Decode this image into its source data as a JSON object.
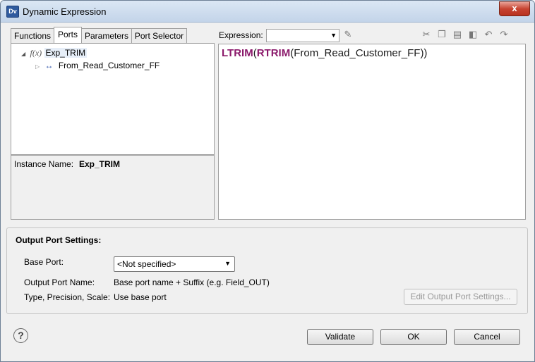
{
  "window": {
    "title": "Dynamic Expression",
    "app_icon": "Dv",
    "close_label": "x"
  },
  "left_panel": {
    "tabs": [
      {
        "label": "Functions"
      },
      {
        "label": "Ports"
      },
      {
        "label": "Parameters"
      },
      {
        "label": "Port Selector"
      }
    ],
    "tree": {
      "root_label": "Exp_TRIM",
      "root_icon": "f(x)",
      "child_label": "From_Read_Customer_FF"
    },
    "instance": {
      "label": "Instance Name:",
      "value": "Exp_TRIM"
    }
  },
  "right_panel": {
    "expression_label": "Expression:",
    "expression_value": "",
    "code": {
      "fn1": "LTRIM",
      "paren1": "(",
      "fn2": "RTRIM",
      "rest": "(From_Read_Customer_FF))"
    }
  },
  "output_settings": {
    "heading": "Output Port Settings:",
    "base_port_label": "Base Port:",
    "base_port_value": "<Not specified>",
    "output_port_name_label": "Output Port Name:",
    "output_port_name_value": "Base port name + Suffix (e.g. Field_OUT)",
    "type_label": "Type, Precision, Scale:",
    "type_value": "Use base port",
    "edit_button": "Edit Output Port Settings..."
  },
  "footer": {
    "help": "?",
    "validate": "Validate",
    "ok": "OK",
    "cancel": "Cancel"
  }
}
